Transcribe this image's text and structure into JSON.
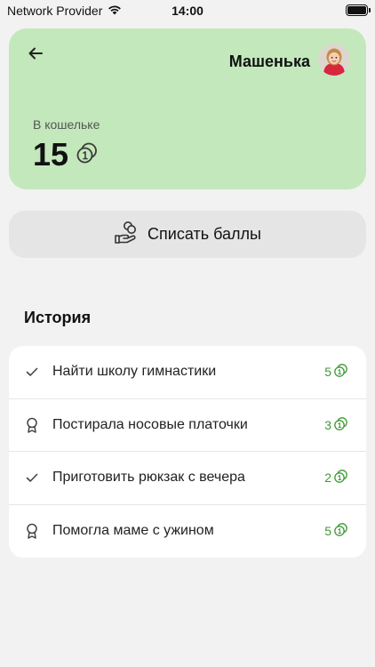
{
  "status_bar": {
    "carrier": "Network Provider",
    "time": "14:00",
    "icons": [
      "wifi-icon",
      "battery-icon"
    ]
  },
  "header": {
    "back_icon": "arrow-left-icon",
    "user_name": "Машенька",
    "avatar": "child-avatar"
  },
  "wallet": {
    "label": "В кошельке",
    "amount": "15",
    "coin_icon": "coin-icon"
  },
  "withdraw": {
    "label": "Списать баллы",
    "icon": "hand-coins-icon"
  },
  "history": {
    "title": "История",
    "items": [
      {
        "icon": "check-icon",
        "label": "Найти школу гимнастики",
        "points": "5"
      },
      {
        "icon": "award-icon",
        "label": "Постирала носовые платочки",
        "points": "3"
      },
      {
        "icon": "check-icon",
        "label": "Приготовить рюкзак с вечера",
        "points": "2"
      },
      {
        "icon": "award-icon",
        "label": "Помогла маме с ужином",
        "points": "5"
      }
    ]
  },
  "colors": {
    "background": "#f2f2f2",
    "wallet_card": "#c3e8bb",
    "withdraw_button": "#e5e5e5",
    "points_accent": "#3d9a34"
  }
}
